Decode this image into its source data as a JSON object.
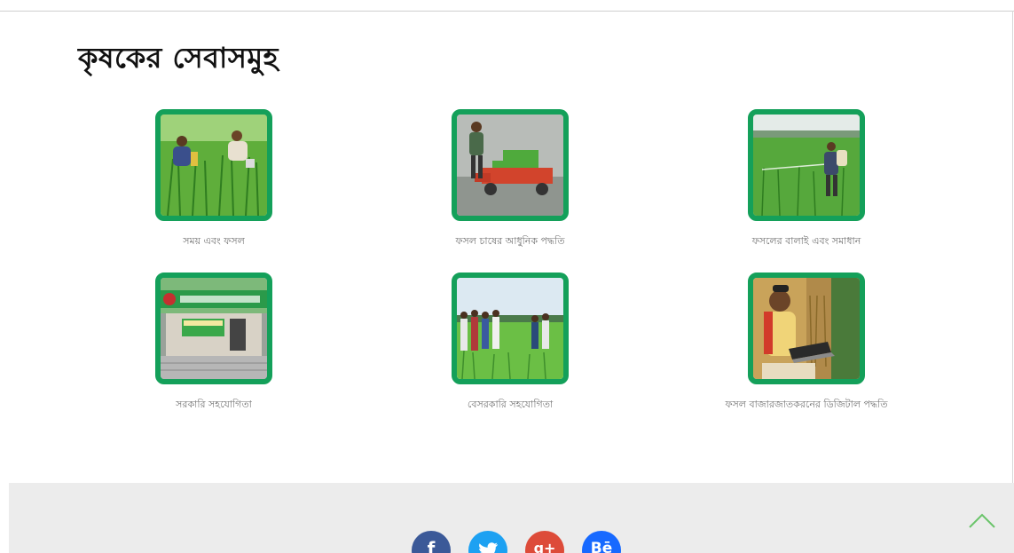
{
  "section": {
    "title": "কৃষকের সেবাসমুহ"
  },
  "services": [
    {
      "label": "সময় এবং ফসল",
      "icon": "rice-field-farmers-photo"
    },
    {
      "label": "ফসল চাষের আধুনিক পদ্ধতি",
      "icon": "rice-transplanter-photo"
    },
    {
      "label": "ফসলের বালাই এবং সমাধান",
      "icon": "pesticide-spraying-photo"
    },
    {
      "label": "সরকারি সহযোগিতা",
      "icon": "agriculture-office-photo"
    },
    {
      "label": "বেসরকারি সহযোগিতা",
      "icon": "field-visit-group-photo"
    },
    {
      "label": "ফসল বাজারজাতকরনের ডিজিটাল পদ্ধতি",
      "icon": "farmer-laptop-photo"
    }
  ],
  "footer": {
    "social": [
      {
        "name": "facebook",
        "glyph": "f",
        "color": "#3b5998"
      },
      {
        "name": "twitter",
        "glyph": "t",
        "color": "#1da1f2"
      },
      {
        "name": "google-plus",
        "glyph": "g+",
        "color": "#dd4b39"
      },
      {
        "name": "behance",
        "glyph": "Bē",
        "color": "#1769ff"
      }
    ]
  },
  "colors": {
    "accent": "#14a05a",
    "footer_bg": "#ececec",
    "back_to_top": "#6ac46a"
  }
}
